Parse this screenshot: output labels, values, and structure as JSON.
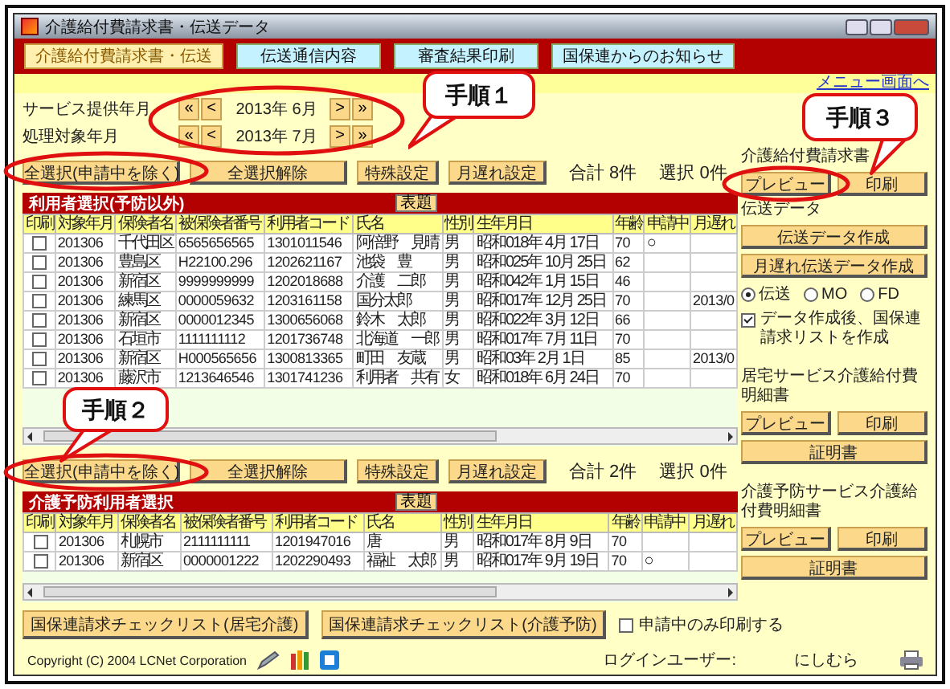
{
  "window": {
    "title": "介護給付費請求書・伝送データ"
  },
  "tabs": [
    {
      "label": "介護給付費請求書・伝送",
      "selected": true
    },
    {
      "label": "伝送通信内容",
      "selected": false
    },
    {
      "label": "審査結果印刷",
      "selected": false
    },
    {
      "label": "国保連からのお知らせ",
      "selected": false
    }
  ],
  "menu_link": "メニュー画面へ",
  "periods": [
    {
      "label": "サービス提供年月",
      "nav": [
        "«",
        "<",
        ">",
        "»"
      ],
      "value": "2013年 6月"
    },
    {
      "label": "処理対象年月",
      "nav": [
        "«",
        "<",
        ">",
        "»"
      ],
      "value": "2013年 7月"
    }
  ],
  "sections": [
    {
      "buttons": [
        "全選択(申請中を除く)",
        "全選択解除",
        "特殊設定",
        "月遅れ設定"
      ],
      "total": "合計 8件",
      "selection": "選択 0件",
      "title": "利用者選択(予防以外)",
      "title_button": "表題",
      "columns": [
        "印刷",
        "対象年月",
        "保険者名",
        "被保険者番号",
        "利用者コード",
        "氏名",
        "性別",
        "生年月日",
        "年齢",
        "申請中",
        "月遅れ"
      ],
      "rows": [
        {
          "print": false,
          "cells": [
            "",
            "201306",
            "千代田区",
            "6565656565",
            "1301011546",
            "阿倍野　見晴",
            "男",
            "昭和018年 4月 17日",
            "70",
            "○",
            ""
          ]
        },
        {
          "print": false,
          "cells": [
            "",
            "201306",
            "豊島区",
            "H22100.296",
            "1202621167",
            "池袋　豊",
            "男",
            "昭和025年 10月 25日",
            "62",
            "",
            ""
          ]
        },
        {
          "print": false,
          "cells": [
            "",
            "201306",
            "新宿区",
            "9999999999",
            "1202018688",
            "介護　二郎",
            "男",
            "昭和042年 1月 15日",
            "46",
            "",
            ""
          ]
        },
        {
          "print": false,
          "cells": [
            "",
            "201306",
            "練馬区",
            "0000059632",
            "1203161158",
            "国分太郎",
            "男",
            "昭和017年 12月 25日",
            "70",
            "",
            "2013/0"
          ]
        },
        {
          "print": false,
          "cells": [
            "",
            "201306",
            "新宿区",
            "0000012345",
            "1300656068",
            "鈴木　太郎",
            "男",
            "昭和022年 3月 12日",
            "66",
            "",
            ""
          ]
        },
        {
          "print": false,
          "cells": [
            "",
            "201306",
            "石垣市",
            "1111111112",
            "1201736748",
            "北海道　一郎",
            "男",
            "昭和017年 7月 11日",
            "70",
            "",
            ""
          ]
        },
        {
          "print": false,
          "cells": [
            "",
            "201306",
            "新宿区",
            "H000565656",
            "1300813365",
            "町田　友蔵",
            "男",
            "昭和03年 2月 1日",
            "85",
            "",
            "2013/0"
          ]
        },
        {
          "print": false,
          "cells": [
            "",
            "201306",
            "藤沢市",
            "1213646546",
            "1301741236",
            "利用者　共有",
            "女",
            "昭和018年 6月 24日",
            "70",
            "",
            ""
          ]
        }
      ]
    },
    {
      "buttons": [
        "全選択(申請中を除く)",
        "全選択解除",
        "特殊設定",
        "月遅れ設定"
      ],
      "total": "合計 2件",
      "selection": "選択 0件",
      "title": "介護予防利用者選択",
      "title_button": "表題",
      "columns": [
        "印刷",
        "対象年月",
        "保険者名",
        "被保険者番号",
        "利用者コード",
        "氏名",
        "性別",
        "生年月日",
        "年齢",
        "申請中",
        "月遅れ"
      ],
      "rows": [
        {
          "print": false,
          "cells": [
            "",
            "201306",
            "札幌市",
            "2111111111",
            "1201947016",
            "唐",
            "男",
            "昭和017年 8月 9日",
            "70",
            "",
            ""
          ]
        },
        {
          "print": false,
          "cells": [
            "",
            "201306",
            "新宿区",
            "0000001222",
            "1202290493",
            "福祉　太郎",
            "男",
            "昭和017年 9月 19日",
            "70",
            "○",
            ""
          ]
        }
      ]
    }
  ],
  "bottom_buttons": [
    "国保連請求チェックリスト(居宅介護)",
    "国保連請求チェックリスト(介護予防)"
  ],
  "print_pending_only": {
    "label": "申請中のみ印刷する",
    "checked": false
  },
  "right_panel": {
    "claim_heading": "介護給付費請求書",
    "claim_buttons": [
      "プレビュー",
      "印刷"
    ],
    "transfer_heading": "伝送データ",
    "transfer_buttons": [
      "伝送データ作成",
      "月遅れ伝送データ作成"
    ],
    "media": [
      {
        "label": "伝送",
        "selected": true
      },
      {
        "label": "MO",
        "selected": false
      },
      {
        "label": "FD",
        "selected": false
      }
    ],
    "make_list": {
      "label": "データ作成後、国保連請求リストを作成",
      "checked": true
    },
    "statements": [
      {
        "heading": "居宅サービス介護給付費明細書",
        "buttons": [
          "プレビュー",
          "印刷"
        ],
        "certificate": "証明書"
      },
      {
        "heading": "介護予防サービス介護給付費明細書",
        "buttons": [
          "プレビュー",
          "印刷"
        ],
        "certificate": "証明書"
      }
    ]
  },
  "footer": {
    "copyright": "Copyright (C) 2004 LCNet Corporation",
    "login_label": "ログインユーザー:",
    "user": "にしむら"
  },
  "callouts": [
    {
      "text": "手順１"
    },
    {
      "text": "手順２"
    },
    {
      "text": "手順３"
    }
  ]
}
